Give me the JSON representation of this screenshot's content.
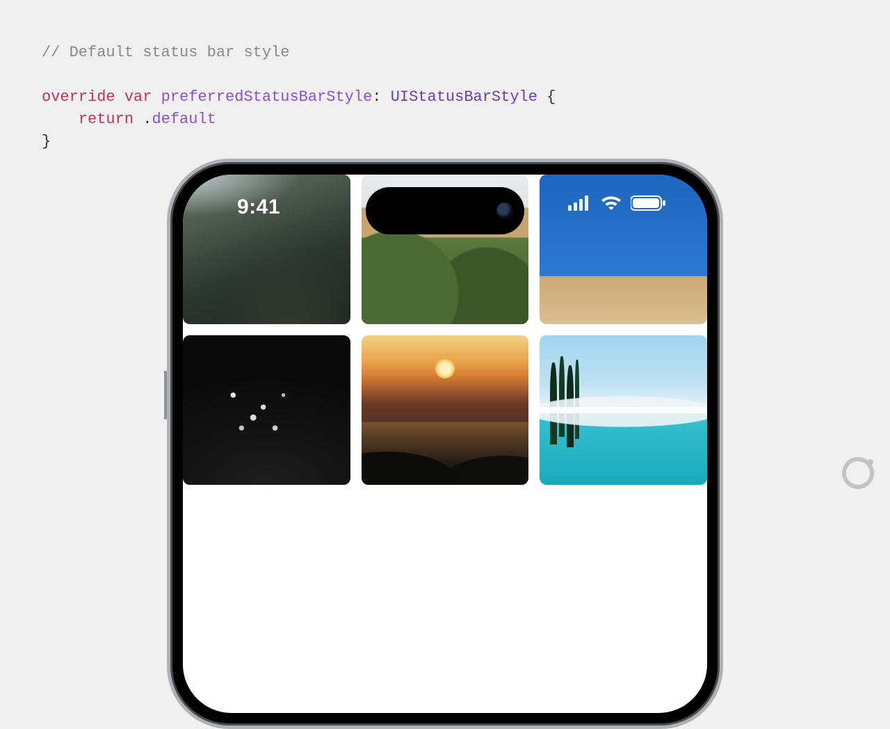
{
  "code": {
    "comment": "// Default status bar style",
    "tok_override": "override",
    "tok_var": "var",
    "tok_name": "preferredStatusBarStyle",
    "tok_colon": ":",
    "tok_type": "UIStatusBarStyle",
    "tok_lbrace": "{",
    "tok_return": "return",
    "tok_dot": ".",
    "tok_default": "default",
    "tok_rbrace": "}"
  },
  "statusbar": {
    "time": "9:41",
    "icons": {
      "cellular": "cellular-icon",
      "wifi": "wifi-icon",
      "battery": "battery-icon"
    }
  },
  "photos": {
    "tiles": [
      {
        "name": "photo-mountain-valley"
      },
      {
        "name": "photo-desert-greenery"
      },
      {
        "name": "photo-blue-sky-dune"
      },
      {
        "name": "photo-bw-flowers"
      },
      {
        "name": "photo-ocean-sunset"
      },
      {
        "name": "photo-lake-pines"
      }
    ]
  }
}
